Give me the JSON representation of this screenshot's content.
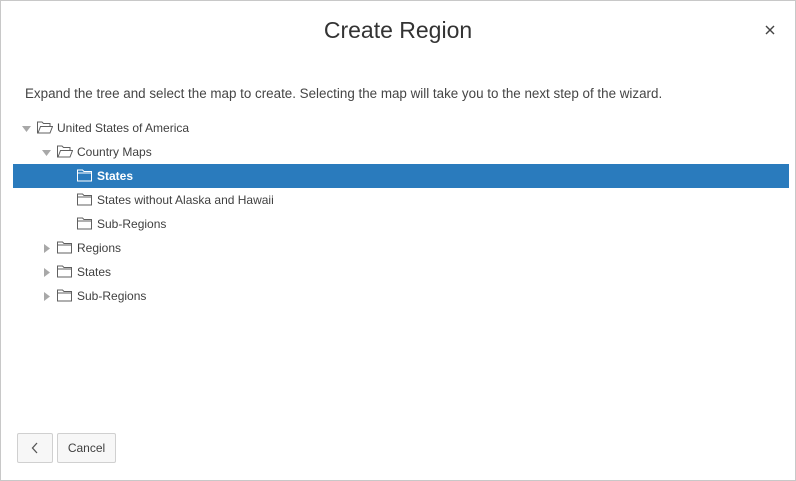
{
  "dialog": {
    "title": "Create Region",
    "close_symbol": "×",
    "instruction": "Expand the tree and select the map to create. Selecting the map will take you to the next step of the wizard."
  },
  "tree": {
    "nodes": [
      {
        "label": "United States of America",
        "level": 0,
        "state": "expanded",
        "icon": "folder-open-icon",
        "selected": false
      },
      {
        "label": "Country Maps",
        "level": 1,
        "state": "expanded",
        "icon": "folder-open-icon",
        "selected": false
      },
      {
        "label": "States",
        "level": 2,
        "state": "leaf",
        "icon": "folder-icon",
        "selected": true
      },
      {
        "label": "States without Alaska and Hawaii",
        "level": 2,
        "state": "leaf",
        "icon": "folder-icon",
        "selected": false
      },
      {
        "label": "Sub-Regions",
        "level": 2,
        "state": "leaf",
        "icon": "folder-icon",
        "selected": false
      },
      {
        "label": "Regions",
        "level": 1,
        "state": "collapsed",
        "icon": "folder-icon",
        "selected": false
      },
      {
        "label": "States",
        "level": 1,
        "state": "collapsed",
        "icon": "folder-icon",
        "selected": false
      },
      {
        "label": "Sub-Regions",
        "level": 1,
        "state": "collapsed",
        "icon": "folder-icon",
        "selected": false
      }
    ]
  },
  "footer": {
    "back_icon": "chevron-left-icon",
    "cancel_label": "Cancel"
  },
  "colors": {
    "selection": "#2a7bbd",
    "text": "#404040"
  }
}
